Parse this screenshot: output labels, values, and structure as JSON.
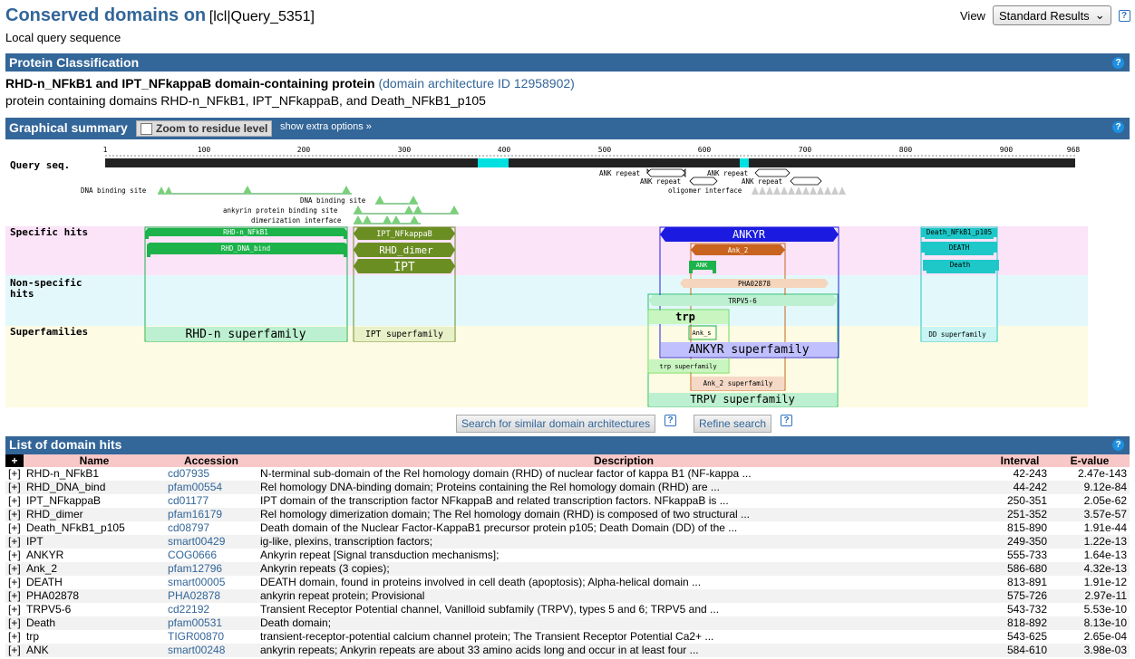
{
  "header": {
    "title": "Conserved domains on",
    "query_id": "[lcl|Query_5351]",
    "subtitle": "Local query sequence",
    "view_label": "View",
    "view_value": "Standard Results"
  },
  "classification": {
    "bar_title": "Protein Classification",
    "name": "RHD-n_NFkB1 and IPT_NFkappaB domain-containing protein",
    "arch_link": "(domain architecture ID 12958902)",
    "desc": "protein containing domains RHD-n_NFkB1, IPT_NFkappaB, and Death_NFkB1_p105"
  },
  "graphical": {
    "bar_title": "Graphical summary",
    "zoom_label": "Zoom to residue level",
    "extra_link": "show extra options »",
    "row_labels": {
      "query": "Query seq.",
      "specific": "Specific hits",
      "nonspecific1": "Non-specific",
      "nonspecific2": "hits",
      "super": "Superfamilies"
    },
    "ruler": [
      "1",
      "100",
      "200",
      "300",
      "400",
      "500",
      "600",
      "700",
      "800",
      "900",
      "968"
    ],
    "sites": [
      "DNA binding site",
      "DNA binding site",
      "ankyrin protein binding site",
      "dimerization interface",
      "ANK repeat",
      "ANK repeat",
      "ANK repeat",
      "ANK repeat",
      "oligomer interface"
    ],
    "domains": [
      "RHD-n_NFkB1",
      "RHD_DNA_bind",
      "IPT_NFkappaB",
      "RHD_dimer",
      "IPT",
      "ANKYR",
      "Ank_2",
      "ANK",
      "PHA02878",
      "TRPV5-6",
      "trp",
      "Ank_s",
      "Death_NFkB1_p105",
      "DEATH",
      "Death"
    ],
    "superfamilies": [
      "RHD-n superfamily",
      "IPT superfamily",
      "ANKYR superfamily",
      "trp superfamily",
      "Ank_2 superfamily",
      "TRPV superfamily",
      "DD superfamily"
    ]
  },
  "buttons": {
    "search_similar": "Search for similar domain architectures",
    "refine": "Refine search"
  },
  "hits": {
    "bar_title": "List of domain hits",
    "expand_all": "+",
    "columns": [
      "Name",
      "Accession",
      "Description",
      "Interval",
      "E-value"
    ],
    "rows": [
      {
        "expand": "[+]",
        "name": "RHD-n_NFkB1",
        "acc": "cd07935",
        "desc": "N-terminal sub-domain of the Rel homology domain (RHD) of nuclear factor of kappa B1 (NF-kappa ...",
        "interval": "42-243",
        "evalue": "2.47e-143"
      },
      {
        "expand": "[+]",
        "name": "RHD_DNA_bind",
        "acc": "pfam00554",
        "desc": "Rel homology DNA-binding domain; Proteins containing the Rel homology domain (RHD) are ...",
        "interval": "44-242",
        "evalue": "9.12e-84"
      },
      {
        "expand": "[+]",
        "name": "IPT_NFkappaB",
        "acc": "cd01177",
        "desc": "IPT domain of the transcription factor NFkappaB and related transcription factors. NFkappaB is ...",
        "interval": "250-351",
        "evalue": "2.05e-62"
      },
      {
        "expand": "[+]",
        "name": "RHD_dimer",
        "acc": "pfam16179",
        "desc": "Rel homology dimerization domain; The Rel homology domain (RHD) is composed of two structural ...",
        "interval": "251-352",
        "evalue": "3.57e-57"
      },
      {
        "expand": "[+]",
        "name": "Death_NFkB1_p105",
        "acc": "cd08797",
        "desc": "Death domain of the Nuclear Factor-KappaB1 precursor protein p105; Death Domain (DD) of the ...",
        "interval": "815-890",
        "evalue": "1.91e-44"
      },
      {
        "expand": "[+]",
        "name": "IPT",
        "acc": "smart00429",
        "desc": "ig-like, plexins, transcription factors;",
        "interval": "249-350",
        "evalue": "1.22e-13"
      },
      {
        "expand": "[+]",
        "name": "ANKYR",
        "acc": "COG0666",
        "desc": "Ankyrin repeat [Signal transduction mechanisms];",
        "interval": "555-733",
        "evalue": "1.64e-13"
      },
      {
        "expand": "[+]",
        "name": "Ank_2",
        "acc": "pfam12796",
        "desc": "Ankyrin repeats (3 copies);",
        "interval": "586-680",
        "evalue": "4.32e-13"
      },
      {
        "expand": "[+]",
        "name": "DEATH",
        "acc": "smart00005",
        "desc": "DEATH domain, found in proteins involved in cell death (apoptosis); Alpha-helical domain ...",
        "interval": "813-891",
        "evalue": "1.91e-12"
      },
      {
        "expand": "[+]",
        "name": "PHA02878",
        "acc": "PHA02878",
        "desc": "ankyrin repeat protein; Provisional",
        "interval": "575-726",
        "evalue": "2.97e-11"
      },
      {
        "expand": "[+]",
        "name": "TRPV5-6",
        "acc": "cd22192",
        "desc": "Transient Receptor Potential channel, Vanilloid subfamily (TRPV), types 5 and 6; TRPV5 and ...",
        "interval": "543-732",
        "evalue": "5.53e-10"
      },
      {
        "expand": "[+]",
        "name": "Death",
        "acc": "pfam00531",
        "desc": "Death domain;",
        "interval": "818-892",
        "evalue": "8.13e-10"
      },
      {
        "expand": "[+]",
        "name": "trp",
        "acc": "TIGR00870",
        "desc": "transient-receptor-potential calcium channel protein; The Transient Receptor Potential Ca2+ ...",
        "interval": "543-625",
        "evalue": "2.65e-04"
      },
      {
        "expand": "[+]",
        "name": "ANK",
        "acc": "smart00248",
        "desc": "ankyrin repeats; Ankyrin repeats are about 33 amino acids long and occur in at least four ...",
        "interval": "584-610",
        "evalue": "3.98e-03"
      }
    ]
  },
  "colors": {
    "bar": "#336699",
    "specific_bg": "#fbe3f8",
    "nonspecific_bg": "#e3f8fb",
    "super_bg": "#fdfbe3"
  }
}
